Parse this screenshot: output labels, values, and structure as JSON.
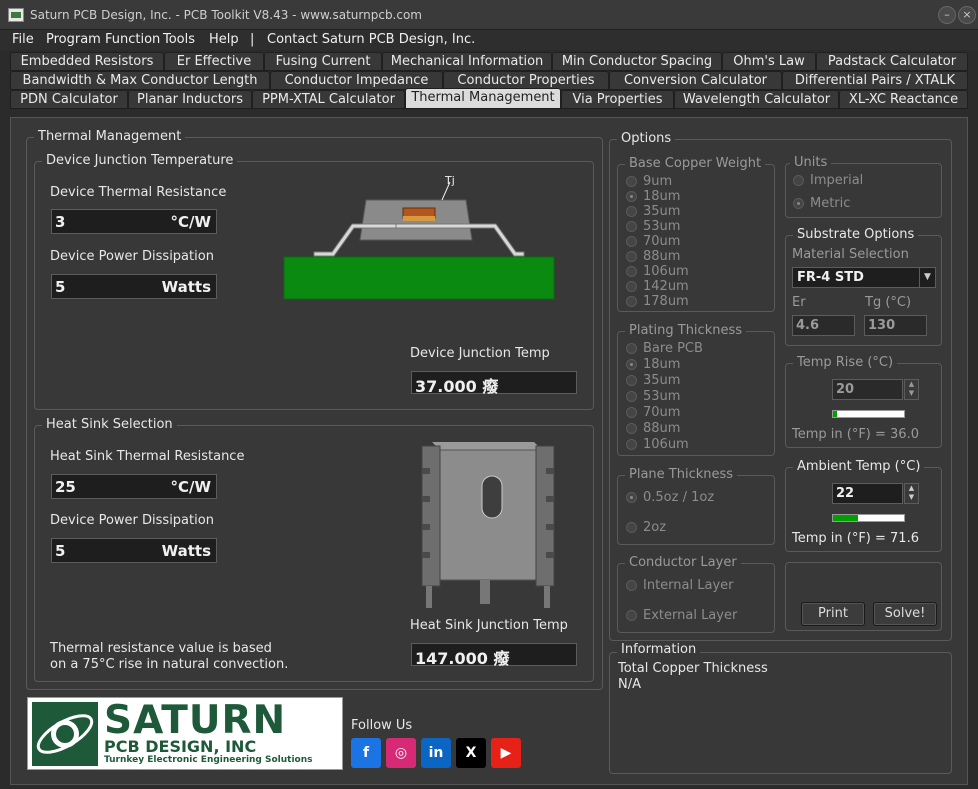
{
  "window": {
    "title": "Saturn PCB Design, Inc. - PCB Toolkit V8.43 - www.saturnpcb.com"
  },
  "menu": {
    "items": [
      "File",
      "Program Function",
      "Tools",
      "Help",
      "|",
      "Contact Saturn PCB Design, Inc."
    ]
  },
  "tabs": {
    "row1": [
      "Embedded Resistors",
      "Er Effective",
      "Fusing Current",
      "Mechanical Information",
      "Min Conductor Spacing",
      "Ohm's Law",
      "Padstack Calculator"
    ],
    "row2": [
      "Bandwidth & Max Conductor Length",
      "Conductor Impedance",
      "Conductor Properties",
      "Conversion Calculator",
      "Differential Pairs / XTALK"
    ],
    "row3": [
      "PDN Calculator",
      "Planar Inductors",
      "PPM-XTAL Calculator",
      "Thermal Management",
      "Via Properties",
      "Wavelength Calculator",
      "XL-XC Reactance"
    ],
    "active": "Thermal Management"
  },
  "thermal": {
    "group_title": "Thermal Management",
    "junction": {
      "title": "Device Junction Temperature",
      "resistance_label": "Device Thermal Resistance",
      "resistance_value": "3",
      "resistance_unit": "°C/W",
      "power_label": "Device Power Dissipation",
      "power_value": "5",
      "power_unit": "Watts",
      "diagram_label": "Tj",
      "result_label": "Device Junction Temp",
      "result_value": "37.000 癈"
    },
    "heatsink": {
      "title": "Heat Sink Selection",
      "resistance_label": "Heat Sink Thermal Resistance",
      "resistance_value": "25",
      "resistance_unit": "°C/W",
      "power_label": "Device Power Dissipation",
      "power_value": "5",
      "power_unit": "Watts",
      "result_label": "Heat Sink Junction Temp",
      "result_value": "147.000 癈",
      "note_line1": "Thermal resistance value is based",
      "note_line2": "on a 75°C rise in natural convection."
    }
  },
  "logo": {
    "brand": "SATURN",
    "sub": "PCB DESIGN, INC",
    "tagline": "Turnkey Electronic Engineering Solutions"
  },
  "social": {
    "label": "Follow Us",
    "icons": [
      "facebook-icon",
      "instagram-icon",
      "linkedin-icon",
      "x-icon",
      "youtube-icon"
    ],
    "glyphs": [
      "f",
      "◎",
      "in",
      "X",
      "▶"
    ]
  },
  "options": {
    "title": "Options",
    "base_copper": {
      "title": "Base Copper Weight",
      "options": [
        "9um",
        "18um",
        "35um",
        "53um",
        "70um",
        "88um",
        "106um",
        "142um",
        "178um"
      ],
      "selected": "18um"
    },
    "plating": {
      "title": "Plating Thickness",
      "options": [
        "Bare PCB",
        "18um",
        "35um",
        "53um",
        "70um",
        "88um",
        "106um"
      ],
      "selected": "18um"
    },
    "plane": {
      "title": "Plane Thickness",
      "options": [
        "0.5oz / 1oz",
        "2oz"
      ],
      "selected": "0.5oz / 1oz"
    },
    "conductor_layer": {
      "title": "Conductor Layer",
      "options": [
        "Internal Layer",
        "External Layer"
      ]
    },
    "units": {
      "title": "Units",
      "options": [
        "Imperial",
        "Metric"
      ],
      "selected": "Metric"
    },
    "substrate": {
      "title": "Substrate Options",
      "material_label": "Material Selection",
      "material_value": "FR-4 STD",
      "er_label": "Er",
      "er_value": "4.6",
      "tg_label": "Tg (°C)",
      "tg_value": "130"
    },
    "temp_rise": {
      "title": "Temp Rise (°C)",
      "value": "20",
      "level": 0.05,
      "f_label": "Temp in (°F) = 36.0"
    },
    "ambient": {
      "title": "Ambient Temp (°C)",
      "value": "22",
      "level": 0.35,
      "f_label": "Temp in (°F) = 71.6"
    },
    "print_label": "Print",
    "solve_label": "Solve!"
  },
  "information": {
    "title": "Information",
    "line1": "Total Copper Thickness",
    "line2": "N/A"
  },
  "colors": {
    "accent_green": "#00a000",
    "board_green": "#0a8a10",
    "logo_green": "#1e5a3a"
  }
}
